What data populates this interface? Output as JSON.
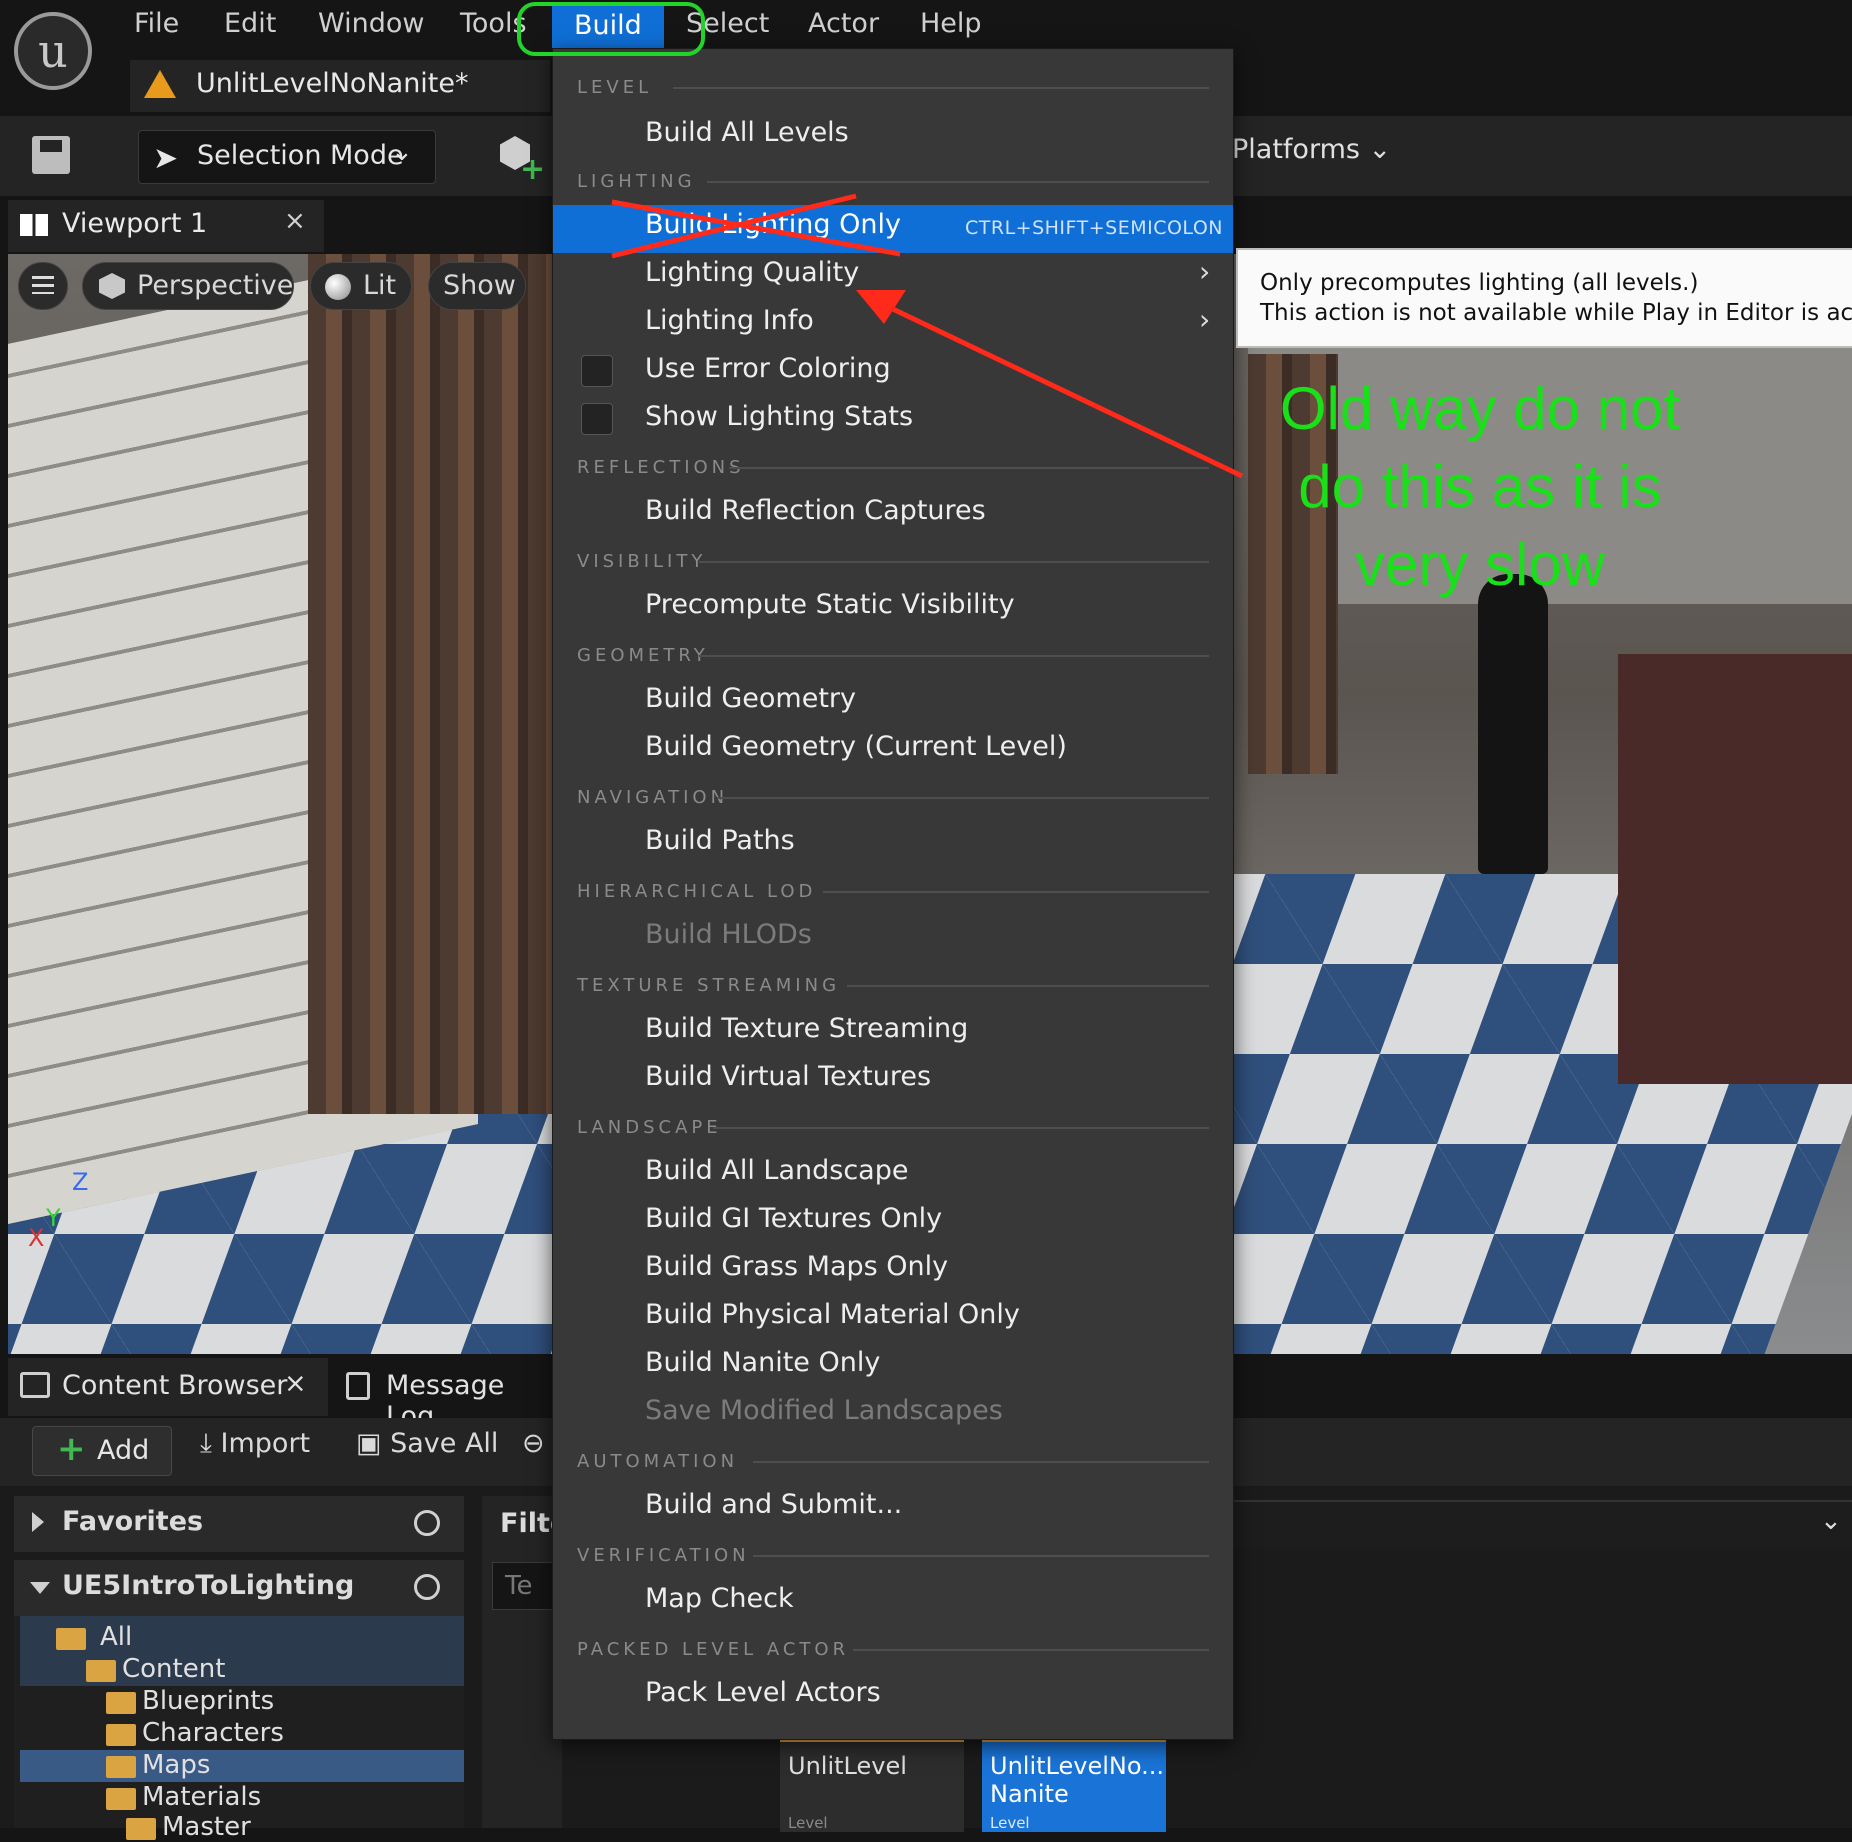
{
  "menubar": {
    "items": [
      "File",
      "Edit",
      "Window",
      "Tools",
      "Build",
      "Select",
      "Actor",
      "Help"
    ]
  },
  "level_tab": {
    "title": "UnlitLevelNoNanite*"
  },
  "toolbar": {
    "selection_mode": "Selection Mode",
    "platforms": "Platforms"
  },
  "viewport_tab": {
    "title": "Viewport 1",
    "close": "×"
  },
  "viewport_controls": {
    "perspective": "Perspective",
    "lit": "Lit",
    "show": "Show"
  },
  "axis_gizmo": {
    "x": "X",
    "y": "Y",
    "z": "Z"
  },
  "build_menu": {
    "sections": [
      {
        "header": "LEVEL",
        "items": [
          {
            "label": "Build All Levels"
          }
        ]
      },
      {
        "header": "LIGHTING",
        "items": [
          {
            "label": "Build Lighting Only",
            "shortcut": "CTRL+SHIFT+SEMICOLON",
            "highlighted": true
          },
          {
            "label": "Lighting Quality",
            "submenu": true
          },
          {
            "label": "Lighting Info",
            "submenu": true
          },
          {
            "label": "Use Error Coloring",
            "checkbox": true
          },
          {
            "label": "Show Lighting Stats",
            "checkbox": true
          }
        ]
      },
      {
        "header": "REFLECTIONS",
        "items": [
          {
            "label": "Build Reflection Captures"
          }
        ]
      },
      {
        "header": "VISIBILITY",
        "items": [
          {
            "label": "Precompute Static Visibility"
          }
        ]
      },
      {
        "header": "GEOMETRY",
        "items": [
          {
            "label": "Build Geometry"
          },
          {
            "label": "Build Geometry (Current Level)"
          }
        ]
      },
      {
        "header": "NAVIGATION",
        "items": [
          {
            "label": "Build Paths"
          }
        ]
      },
      {
        "header": "HIERARCHICAL LOD",
        "items": [
          {
            "label": "Build HLODs",
            "disabled": true
          }
        ]
      },
      {
        "header": "TEXTURE STREAMING",
        "items": [
          {
            "label": "Build Texture Streaming"
          },
          {
            "label": "Build Virtual Textures"
          }
        ]
      },
      {
        "header": "LANDSCAPE",
        "items": [
          {
            "label": "Build All Landscape"
          },
          {
            "label": "Build GI Textures Only"
          },
          {
            "label": "Build Grass Maps Only"
          },
          {
            "label": "Build Physical Material Only"
          },
          {
            "label": "Build Nanite Only"
          },
          {
            "label": "Save Modified Landscapes",
            "disabled": true
          }
        ]
      },
      {
        "header": "AUTOMATION",
        "items": [
          {
            "label": "Build and Submit..."
          }
        ]
      },
      {
        "header": "VERIFICATION",
        "items": [
          {
            "label": "Map Check"
          }
        ]
      },
      {
        "header": "PACKED LEVEL ACTOR",
        "items": [
          {
            "label": "Pack Level Actors"
          }
        ]
      }
    ]
  },
  "tooltip": {
    "line1": "Only precomputes lighting (all levels.)",
    "line2": "This action is not available while Play in Editor is active"
  },
  "annotation": {
    "line1": "Old way do not",
    "line2": "do this as it is",
    "line3": "very slow",
    "color": "#1ae01a",
    "arrow_color": "#ff2a1a"
  },
  "content_browser": {
    "tab_title": "Content Browser",
    "tab_close": "×",
    "message_log": "Message Log",
    "add": "Add",
    "import": "Import",
    "save_all": "Save All",
    "favorites": "Favorites",
    "project": "UE5IntroToLighting",
    "filter_header": "Filte",
    "search_placeholder": "Te",
    "tree": [
      "All",
      "Content",
      "Blueprints",
      "Characters",
      "Maps",
      "Materials",
      "Master"
    ],
    "assets": [
      {
        "name": "UnlitLevel",
        "type": "Level"
      },
      {
        "name": "UnlitLevelNo...",
        "name_line2": "Nanite",
        "type": "Level"
      }
    ]
  },
  "colors": {
    "accent": "#0f6fd6",
    "menu_bg": "#383838",
    "panel_bg": "#242424",
    "highlight_circle": "#22d42a"
  }
}
